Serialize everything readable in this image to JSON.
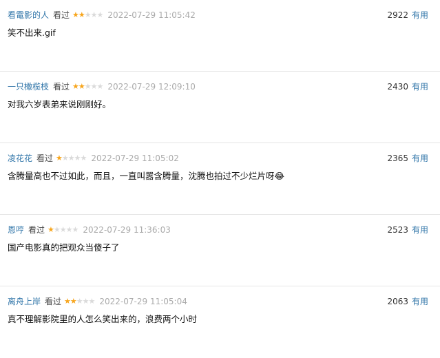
{
  "comments": [
    {
      "user": "看電影的人",
      "status": "看过",
      "rating": 2,
      "rating_max": 5,
      "time": "2022-07-29 11:05:42",
      "votes": "2922",
      "vote_label": "有用",
      "text": "笑不出来.gif"
    },
    {
      "user": "一只橄榄枝",
      "status": "看过",
      "rating": 2,
      "rating_max": 5,
      "time": "2022-07-29 12:09:10",
      "votes": "2430",
      "vote_label": "有用",
      "text": "对我六岁表弟来说刚刚好。"
    },
    {
      "user": "凌花花",
      "status": "看过",
      "rating": 1,
      "rating_max": 5,
      "time": "2022-07-29 11:05:02",
      "votes": "2365",
      "vote_label": "有用",
      "text": "含腾量高也不过如此，而且，一直叫嚣含腾量，沈腾也拍过不少烂片呀😂"
    },
    {
      "user": "恩哼",
      "status": "看过",
      "rating": 1,
      "rating_max": 5,
      "time": "2022-07-29 11:36:03",
      "votes": "2523",
      "vote_label": "有用",
      "text": "国产电影真的把观众当傻子了"
    },
    {
      "user": "离舟上岸",
      "status": "看过",
      "rating": 2,
      "rating_max": 5,
      "time": "2022-07-29 11:05:04",
      "votes": "2063",
      "vote_label": "有用",
      "text": "真不理解影院里的人怎么笑出来的，浪费两个小时"
    }
  ],
  "colors": {
    "link": "#3377aa",
    "star_on": "#f7a51c",
    "star_off": "#dadada",
    "time": "#aaaaaa",
    "divider": "#e5e5e5"
  }
}
